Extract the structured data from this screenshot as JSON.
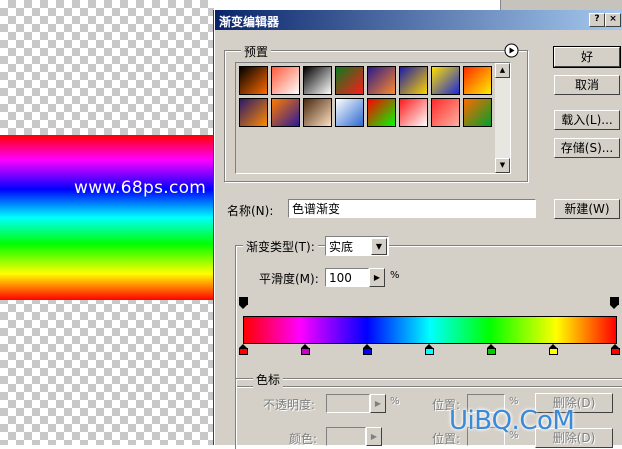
{
  "canvas": {
    "watermark": "www.68ps.com"
  },
  "dialog": {
    "title": "渐变编辑器",
    "title_controls": [
      "?",
      "×"
    ],
    "presets": {
      "label": "预置",
      "menu_icon": "circle-arrow-right-icon",
      "swatches_row1": [
        [
          "#000000",
          "#ff6a00"
        ],
        [
          "#ff5a3a",
          "#ffffff"
        ],
        [
          "#000000",
          "#ffffff"
        ],
        [
          "#0b7a1f",
          "#ff1a1a"
        ],
        [
          "#2a1a8a",
          "#ff8a2a"
        ],
        [
          "#1a1aa8",
          "#ffd400"
        ],
        [
          "#ffe000",
          "#1a28d8"
        ],
        [
          "#ff2a00",
          "#ffee00"
        ]
      ],
      "swatches_row2": [
        [
          "#2a1a6a",
          "#ff8a00"
        ],
        [
          "#ff7a00",
          "#2a1a9a"
        ],
        [
          "#4a2a10",
          "#ffe0c0"
        ],
        [
          "#ffffff",
          "#2a68d0"
        ],
        [
          "#ff0000",
          "#00ff00"
        ],
        [
          "#ff1a1a",
          "#ffffff"
        ],
        [
          "#ff2a2a",
          "#ffb0a0"
        ],
        [
          "#ff6a00",
          "#00a02a"
        ]
      ]
    },
    "buttons": {
      "ok": "好",
      "cancel": "取消",
      "load": "载入(L)...",
      "save": "存储(S)...",
      "new": "新建(W)"
    },
    "name": {
      "label": "名称(N):",
      "value": "色谱渐变"
    },
    "gradient_type": {
      "label": "渐变类型(T):",
      "value": "实底"
    },
    "smoothness": {
      "label": "平滑度(M):",
      "value": "100",
      "unit": "%"
    },
    "color_stops": [
      "#ff0000",
      "#cc00cc",
      "#0000ff",
      "#00ffff",
      "#00cc00",
      "#ffff00",
      "#ff0000"
    ],
    "stops_group": {
      "label": "色标",
      "opacity_label": "不透明度:",
      "opacity_unit": "%",
      "location_label": "位置:",
      "location_unit": "%",
      "delete_label": "删除(D)",
      "color_label": "颜色:",
      "location_label2": "位置:",
      "location_unit2": "%",
      "delete_label2": "删除(D)"
    }
  },
  "overlay_watermark": "UiBQ.CoM"
}
